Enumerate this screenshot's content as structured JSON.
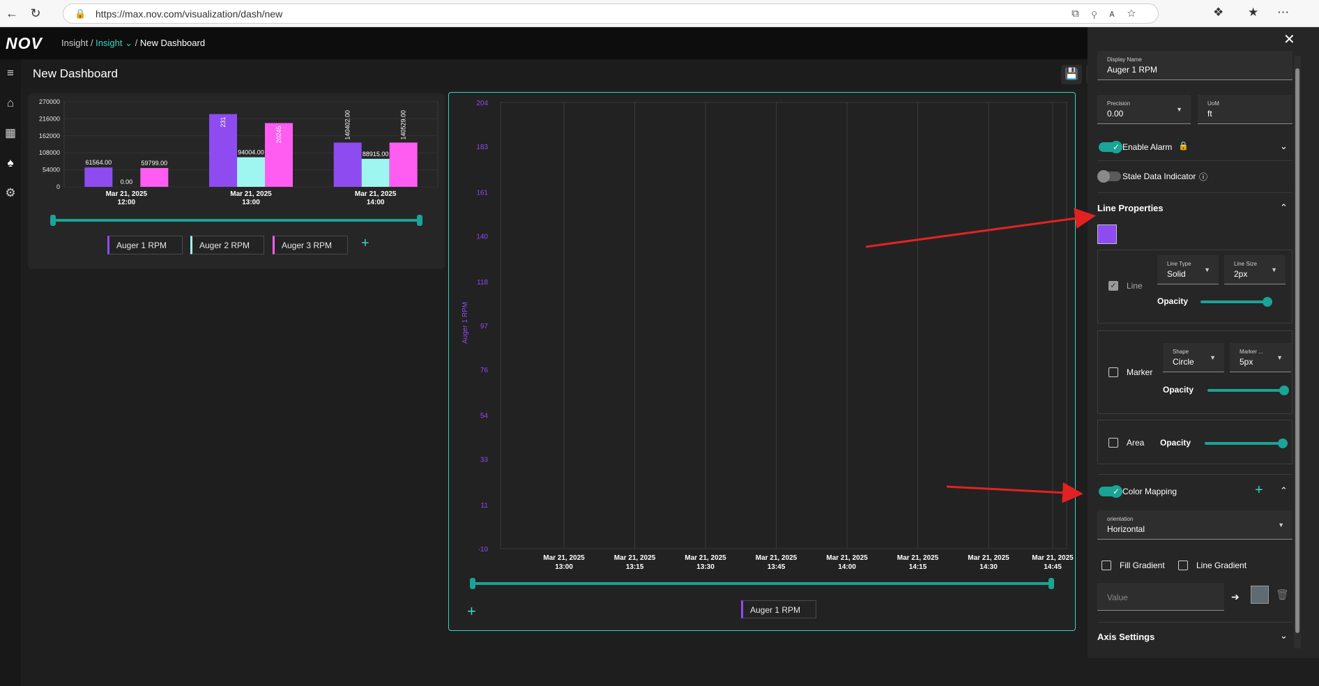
{
  "browser": {
    "url": "https://max.nov.com/visualization/dash/new"
  },
  "app": {
    "logo": "NOV",
    "breadcrumb": {
      "root": "Insight",
      "active": "Insight",
      "current": "New Dashboard"
    },
    "page_title": "New Dashboard"
  },
  "colors": {
    "accent": "#36d6c3",
    "series1": "#8e4cf0",
    "series2": "#9ff6f0",
    "series3": "#ff5cf2"
  },
  "chart_data": [
    {
      "type": "bar",
      "categories": [
        "Mar 21, 2025\n12:00",
        "Mar 21, 2025\n13:00",
        "Mar 21, 2025\n14:00"
      ],
      "category_lines": [
        [
          "Mar 21, 2025",
          "12:00"
        ],
        [
          "Mar 21, 2025",
          "13:00"
        ],
        [
          "Mar 21, 2025",
          "14:00"
        ]
      ],
      "series": [
        {
          "name": "Auger 1 RPM",
          "values": [
            61564,
            231000,
            140402
          ],
          "labels": [
            "61564.00",
            "231",
            "140402.00"
          ]
        },
        {
          "name": "Auger 2 RPM",
          "values": [
            0,
            94004,
            88915
          ],
          "labels": [
            "0.00",
            "94004.00",
            "88915.00"
          ]
        },
        {
          "name": "Auger 3 RPM",
          "values": [
            59799,
            202458,
            140529
          ],
          "labels": [
            "59799.00",
            "20245",
            "140529.00"
          ]
        }
      ],
      "yticks": [
        "270000",
        "216000",
        "162000",
        "108000",
        "54000",
        "0"
      ],
      "ylim": [
        0,
        270000
      ]
    },
    {
      "type": "line",
      "ylabel": "Auger 1 RPM",
      "yticks": [
        "204",
        "183",
        "161",
        "140",
        "118",
        "97",
        "76",
        "54",
        "33",
        "11",
        "-10"
      ],
      "ylim": [
        -10,
        204
      ],
      "xticks": [
        [
          "Mar 21, 2025",
          "13:00"
        ],
        [
          "Mar 21, 2025",
          "13:15"
        ],
        [
          "Mar 21, 2025",
          "13:30"
        ],
        [
          "Mar 21, 2025",
          "13:45"
        ],
        [
          "Mar 21, 2025",
          "14:00"
        ],
        [
          "Mar 21, 2025",
          "14:15"
        ],
        [
          "Mar 21, 2025",
          "14:30"
        ],
        [
          "Mar 21, 2025",
          "14:45"
        ]
      ],
      "series": [
        {
          "name": "Auger 1 RPM",
          "values": []
        }
      ]
    }
  ],
  "line_legend": "Auger 1 RPM",
  "panel": {
    "display_name": {
      "label": "Display Name",
      "value": "Auger 1 RPM"
    },
    "precision": {
      "label": "Precision",
      "value": "0.00"
    },
    "uom": {
      "label": "UoM",
      "value": "ft"
    },
    "enable_alarm": "Enable Alarm",
    "stale_data": "Stale Data Indicator",
    "line_properties": "Line Properties",
    "line": {
      "label": "Line",
      "type_label": "Line Type",
      "type_value": "Solid",
      "size_label": "Line Size",
      "size_value": "2px",
      "opacity": "Opacity",
      "opacity_level": 1.0
    },
    "marker": {
      "label": "Marker",
      "shape_label": "Shape",
      "shape_value": "Circle",
      "size_label": "Marker ...",
      "size_value": "5px",
      "opacity": "Opacity",
      "opacity_level": 1.0
    },
    "area": {
      "label": "Area",
      "opacity": "Opacity",
      "opacity_level": 1.0
    },
    "color_mapping": "Color Mapping",
    "orientation": {
      "label": "orientation",
      "value": "Horizontal"
    },
    "fill_gradient": "Fill Gradient",
    "line_gradient": "Line Gradient",
    "value_placeholder": "Value",
    "axis_settings": "Axis Settings"
  }
}
